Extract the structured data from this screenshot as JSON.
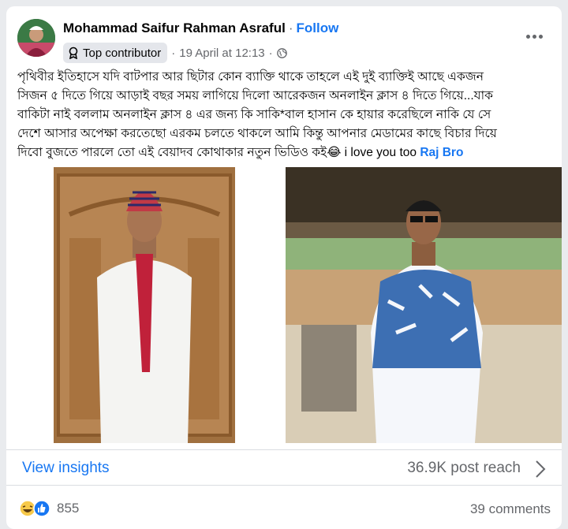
{
  "post": {
    "author": "Mohammad Saifur Rahman Asraful",
    "follow_label": "Follow",
    "badge_label": "Top contributor",
    "timestamp": "19 April at 12:13",
    "text_lines": [
      "পৃথিবীর ইতিহাসে যদি বাটপার আর ছিটার কোন ব্যাক্তি থাকে তাহলে এই দুই ব্যাক্তিই আছে একজন",
      "সিজন ৫ দিতে গিয়ে আড়াই বছর সময় লাগিয়ে দিলো আরেকজন অনলাইন ক্লাস ৪ দিতে গিয়ে...যাক",
      "বাকিটা নাই বললাম অনলাইন ক্লাস ৪ এর জন্য কি সাকি*বাল হাসান কে হায়ার করেছিলে নাকি যে সে",
      "দেশে আসার অপেক্ষা করতেছো  এরকম চলতে থাকলে আমি কিন্তু আপনার মেডামের কাছে বিচার দিয়ে",
      "দিবো বুজতে পারলে তো এই বেয়াদব কোথাকার নতুন ভিডিও কই😂 i love you too"
    ],
    "mention": "Raj Bro"
  },
  "insights": {
    "link_label": "View insights",
    "reach_label": "36.9K post reach"
  },
  "footer": {
    "reaction_count": "855",
    "comments_label": "39 comments"
  },
  "colors": {
    "accent": "#1877f2",
    "secondary_text": "#65676b",
    "divider": "#dadde1"
  },
  "icons": [
    "avatar",
    "contributor-badge-icon",
    "globe-icon",
    "more-icon",
    "chevron-right-icon",
    "haha-reaction-icon",
    "like-reaction-icon"
  ]
}
